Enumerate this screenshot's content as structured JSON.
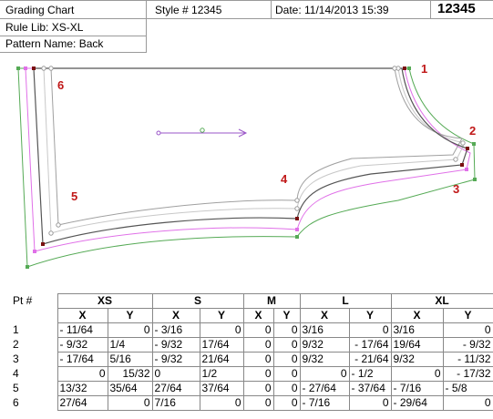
{
  "header": {
    "title": "Grading Chart",
    "style": "Style # 12345",
    "date": "Date: 11/14/2013 15:39",
    "number": "12345",
    "rule_lib": "Rule Lib: XS-XL",
    "pattern_name": "Pattern Name: Back"
  },
  "points": {
    "p1": "1",
    "p2": "2",
    "p3": "3",
    "p4": "4",
    "p5": "5",
    "p6": "6"
  },
  "colors": {
    "base": "#555555",
    "xs": "#a0a0a0",
    "s": "#c8c8c8",
    "l": "#e070e8",
    "xl": "#55aa55",
    "label": "#c01818",
    "grainline": "#9a55c8"
  },
  "table": {
    "pt_header": "Pt #",
    "sizes": [
      "XS",
      "S",
      "M",
      "L",
      "XL"
    ],
    "axis_x": "X",
    "axis_y": "Y",
    "rows": [
      {
        "pt": "1",
        "vals": [
          "- 11/64",
          "0",
          "- 3/16",
          "0",
          "0",
          "0",
          "3/16",
          "0",
          "3/16",
          "0"
        ]
      },
      {
        "pt": "2",
        "vals": [
          "- 9/32",
          "1/4",
          "- 9/32",
          "17/64",
          "0",
          "0",
          "9/32",
          "- 17/64",
          "19/64",
          "- 9/32"
        ]
      },
      {
        "pt": "3",
        "vals": [
          "- 17/64",
          "5/16",
          "- 9/32",
          "21/64",
          "0",
          "0",
          "9/32",
          "- 21/64",
          "9/32",
          "- 11/32"
        ]
      },
      {
        "pt": "4",
        "vals": [
          "0",
          "15/32",
          "0",
          "1/2",
          "0",
          "0",
          "0",
          "- 1/2",
          "0",
          "- 17/32"
        ]
      },
      {
        "pt": "5",
        "vals": [
          "13/32",
          "35/64",
          "27/64",
          "37/64",
          "0",
          "0",
          "- 27/64",
          "- 37/64",
          "- 7/16",
          "- 5/8"
        ]
      },
      {
        "pt": "6",
        "vals": [
          "27/64",
          "0",
          "7/16",
          "0",
          "0",
          "0",
          "- 7/16",
          "0",
          "- 29/64",
          "0"
        ]
      }
    ]
  }
}
